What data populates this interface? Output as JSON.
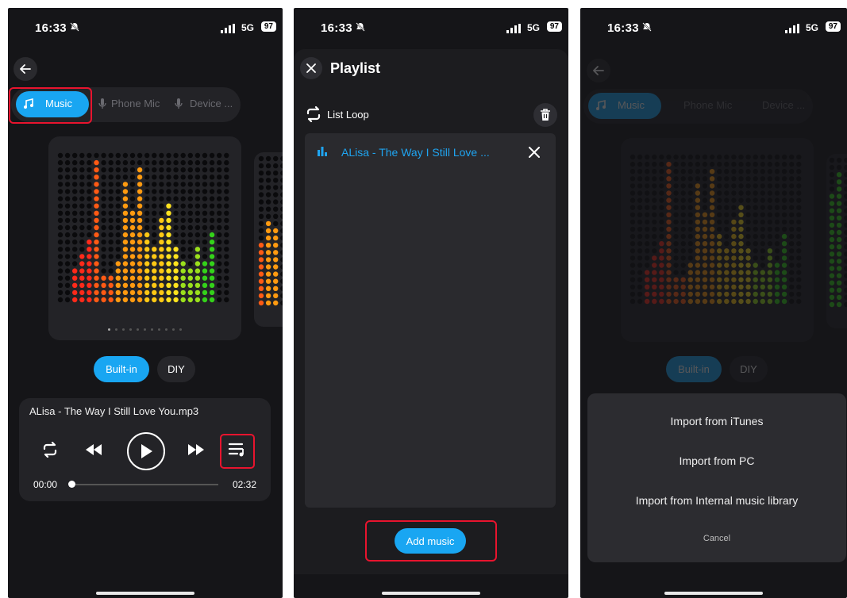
{
  "status": {
    "time": "16:33",
    "network": "5G",
    "battery": "97"
  },
  "screen1": {
    "tabs": [
      {
        "label": "Music"
      },
      {
        "label": "Phone Mic"
      },
      {
        "label": "Device ..."
      }
    ],
    "mode_buttons": {
      "builtin": "Built-in",
      "diy": "DIY"
    },
    "player": {
      "track": "ALisa - The Way I Still Love You.mp3",
      "time_current": "00:00",
      "time_total": "02:32"
    },
    "colors": {
      "accent": "#19a6f2",
      "highlight": "#e8142e"
    }
  },
  "screen2": {
    "title": "Playlist",
    "loop_mode": "List Loop",
    "items": [
      {
        "title": "ALisa - The Way I Still Love ..."
      }
    ],
    "add_button": "Add music"
  },
  "screen3": {
    "menu": [
      "Import from iTunes",
      "Import from PC",
      "Import from Internal music library"
    ],
    "cancel": "Cancel"
  }
}
